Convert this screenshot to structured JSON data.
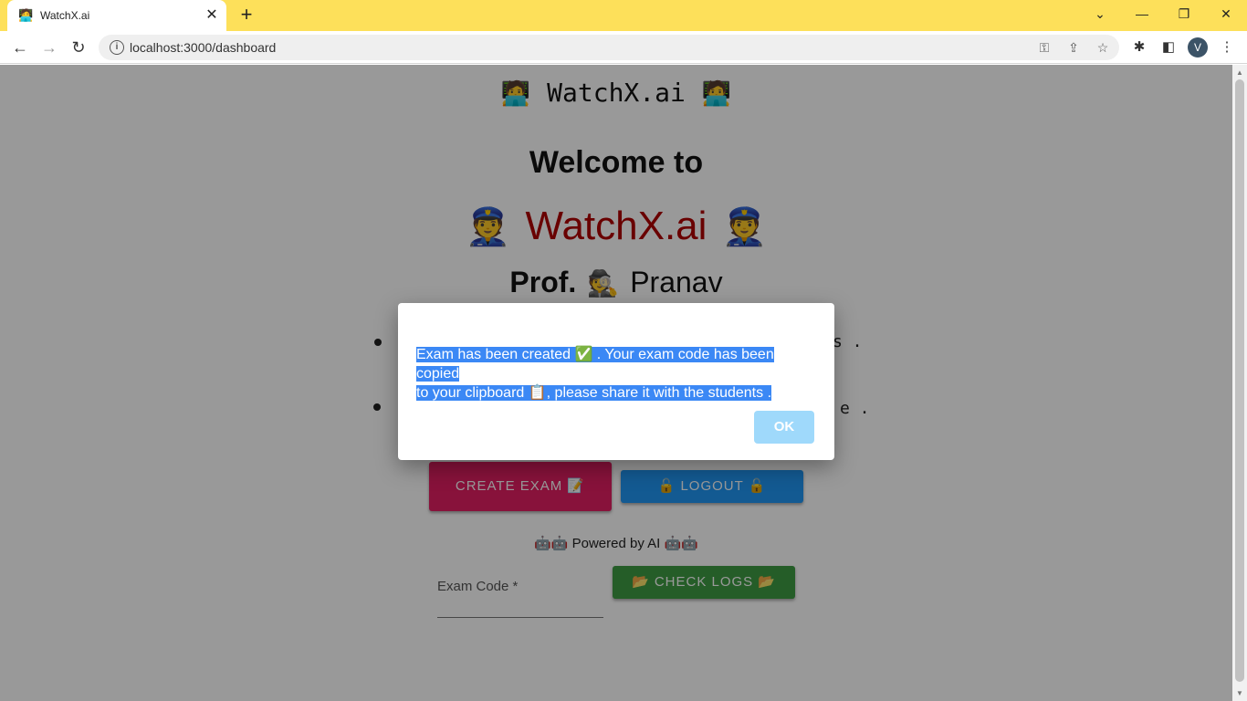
{
  "browser": {
    "tab_title": "WatchX.ai",
    "tab_icon": "🧑‍💻",
    "url": "localhost:3000/dashboard",
    "profile_initial": "V"
  },
  "page": {
    "brand_text": "WatchX.ai",
    "brand_emoji": "🧑‍💻",
    "welcome_text": "Welcome to",
    "hero_text": "WatchX.ai",
    "hero_emoji": "👮",
    "prof_label": "Prof.",
    "prof_emoji": "🕵️",
    "prof_name": "Pranav",
    "bullet_1_tail": "s .",
    "bullet_2_tail": "e .",
    "create_exam_label": "CREATE EXAM 📝",
    "logout_label": "🔓 LOGOUT 🔓",
    "powered_text": "🤖🤖 Powered by AI 🤖🤖",
    "exam_code_label": "Exam Code *",
    "check_logs_label": "📂 CHECK LOGS 📂"
  },
  "dialog": {
    "message_line1": "Exam has been created ✅ . Your exam code has been copied",
    "message_line2": "to your clipboard 📋, please share it with the students .",
    "ok_label": "OK"
  },
  "colors": {
    "tabbar": "#fde05a",
    "hero": "#b00000",
    "create_exam": "#e31f63",
    "logout": "#2196f3",
    "check_logs": "#3e9b43",
    "ok_button": "#9fd9fb",
    "selection": "#3b88f5"
  }
}
